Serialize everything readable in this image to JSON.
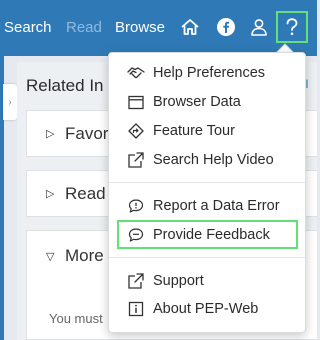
{
  "nav": {
    "search": "Search",
    "read": "Read",
    "browse": "Browse"
  },
  "icons": {
    "home": "home-icon",
    "facebook": "facebook-icon",
    "user": "user-icon",
    "help": "help-icon"
  },
  "panel": {
    "title": "Related In",
    "link": "ll",
    "cards": [
      {
        "label": "Favor"
      },
      {
        "label": "Read"
      },
      {
        "label": "More",
        "body": "You must"
      }
    ]
  },
  "menu": {
    "items": [
      {
        "label": "Help Preferences",
        "icon": "handshake-icon"
      },
      {
        "label": "Browser Data",
        "icon": "window-icon"
      },
      {
        "label": "Feature Tour",
        "icon": "signpost-icon"
      },
      {
        "label": "Search Help Video",
        "icon": "external-link-icon"
      },
      {
        "label": "Report a Data Error",
        "icon": "comment-alert-icon"
      },
      {
        "label": "Provide Feedback",
        "icon": "comment-icon"
      },
      {
        "label": "Support",
        "icon": "external-link-icon"
      },
      {
        "label": "About PEP-Web",
        "icon": "info-box-icon"
      }
    ]
  },
  "colors": {
    "topbar": "#2f7ab6",
    "highlight": "#63e07a"
  }
}
